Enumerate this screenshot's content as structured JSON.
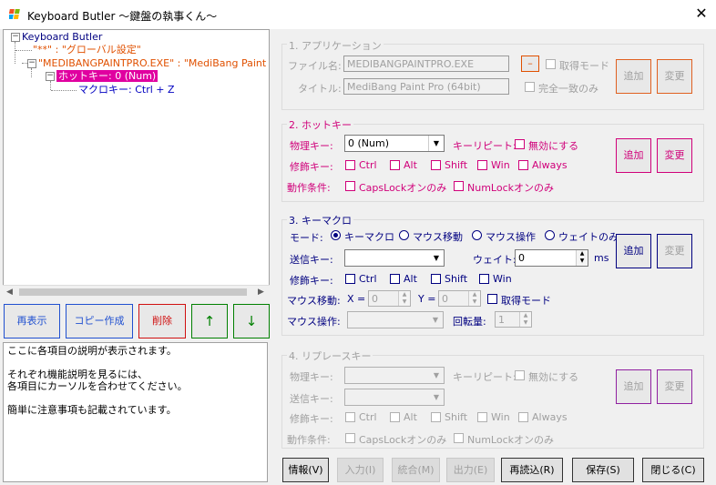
{
  "window": {
    "title": "Keyboard Butler 〜鍵盤の執事くん〜",
    "close_glyph": "✕"
  },
  "tree": {
    "root": "Keyboard Butler",
    "global": "\"**\" : \"グローバル設定\"",
    "app": "\"MEDIBANGPAINTPRO.EXE\" : \"MediBang Paint",
    "hotkey": "ホットキー: 0 (Num)",
    "macro": "マクロキー: Ctrl + Z"
  },
  "buttons": {
    "reload": "再表示",
    "copy": "コピー作成",
    "delete": "削除",
    "up": "↑",
    "down": "↓"
  },
  "description": {
    "line1": "ここに各項目の説明が表示されます。",
    "line2": "それぞれ機能説明を見るには、",
    "line3": "各項目にカーソルを合わせてください。",
    "line4": "簡単に注意事項も記載されています。"
  },
  "app_group": {
    "title": "1. アプリケーション",
    "file_label": "ファイル名:",
    "file_value": "MEDIBANGPAINTPRO.EXE",
    "title_label": "タイトル:",
    "title_value": "MediBang Paint Pro (64bit)",
    "dash": "–",
    "acquire_mode": "取得モード",
    "exact_match": "完全一致のみ",
    "add": "追加",
    "change": "変更"
  },
  "hotkey_group": {
    "title": "2. ホットキー",
    "phys_label": "物理キー:",
    "phys_value": "0 (Num)",
    "repeat_label": "キーリピート:",
    "disable": "無効にする",
    "mod_label": "修飾キー:",
    "mods": [
      "Ctrl",
      "Alt",
      "Shift",
      "Win",
      "Always"
    ],
    "cond_label": "動作条件:",
    "capslock": "CapsLockオンのみ",
    "numlock": "NumLockオンのみ",
    "add": "追加",
    "change": "変更"
  },
  "macro_group": {
    "title": "3. キーマクロ",
    "mode_label": "モード:",
    "modes": [
      "キーマクロ",
      "マウス移動",
      "マウス操作",
      "ウェイトのみ"
    ],
    "send_label": "送信キー:",
    "wait_label": "ウェイト:",
    "wait_value": "0",
    "ms": "ms",
    "mod_label": "修飾キー:",
    "mods": [
      "Ctrl",
      "Alt",
      "Shift",
      "Win"
    ],
    "move_label": "マウス移動:",
    "x_label": "X =",
    "x_value": "0",
    "y_label": "Y =",
    "y_value": "0",
    "acquire_mode": "取得モード",
    "op_label": "マウス操作:",
    "rot_label": "回転量:",
    "rot_value": "1",
    "add": "追加",
    "change": "変更"
  },
  "replace_group": {
    "title": "4. リプレースキー",
    "phys_label": "物理キー:",
    "repeat_label": "キーリピート:",
    "disable": "無効にする",
    "send_label": "送信キー:",
    "mod_label": "修飾キー:",
    "mods": [
      "Ctrl",
      "Alt",
      "Shift",
      "Win",
      "Always"
    ],
    "cond_label": "動作条件:",
    "capslock": "CapsLockオンのみ",
    "numlock": "NumLockオンのみ",
    "add": "追加",
    "change": "変更"
  },
  "bottom": {
    "info": "情報(V)",
    "input": "入力(I)",
    "merge": "統合(M)",
    "output": "出力(E)",
    "reread": "再読込(R)",
    "save": "保存(S)",
    "close": "閉じる(C)"
  }
}
